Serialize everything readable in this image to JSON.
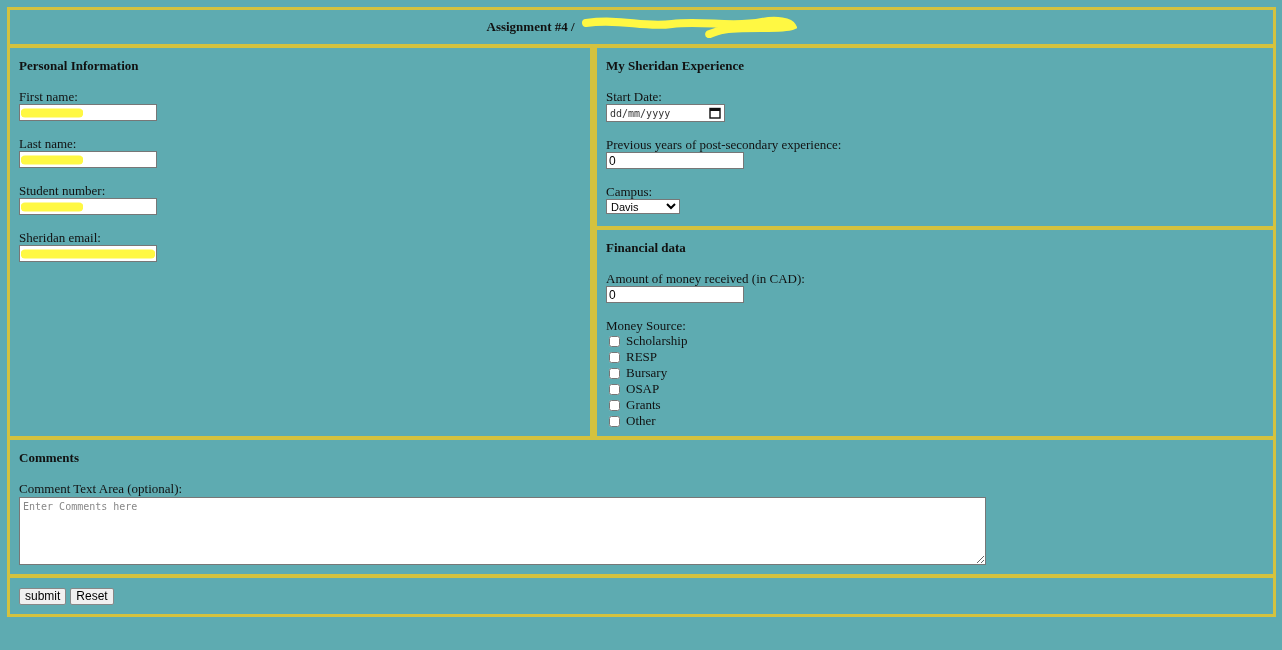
{
  "header": {
    "title": "Assignment #4 / ",
    "title_redacted": true
  },
  "personal": {
    "heading": "Personal Information",
    "fields": [
      {
        "label": "First name:",
        "redacted": true
      },
      {
        "label": "Last name:",
        "redacted": true
      },
      {
        "label": "Student number:",
        "redacted": true
      },
      {
        "label": "Sheridan email:",
        "redacted": true
      }
    ]
  },
  "experience": {
    "heading": "My Sheridan Experience",
    "start_date": {
      "label": "Start Date:",
      "placeholder": "dd/mm/yyyy"
    },
    "years": {
      "label": "Previous years of post-secondary experience:",
      "value": "0"
    },
    "campus": {
      "label": "Campus:",
      "value": "Davis"
    }
  },
  "financial": {
    "heading": "Financial data",
    "amount": {
      "label": "Amount of money received (in CAD):",
      "value": "0"
    },
    "source_label": "Money Source:",
    "sources": [
      {
        "label": "Scholarship",
        "checked": false
      },
      {
        "label": "RESP",
        "checked": false
      },
      {
        "label": "Bursary",
        "checked": false
      },
      {
        "label": "OSAP",
        "checked": false
      },
      {
        "label": "Grants",
        "checked": false
      },
      {
        "label": "Other",
        "checked": false
      }
    ]
  },
  "comments": {
    "heading": "Comments",
    "label": "Comment Text Area (optional):",
    "placeholder": "Enter Comments here"
  },
  "buttons": [
    "submit",
    "Reset"
  ]
}
